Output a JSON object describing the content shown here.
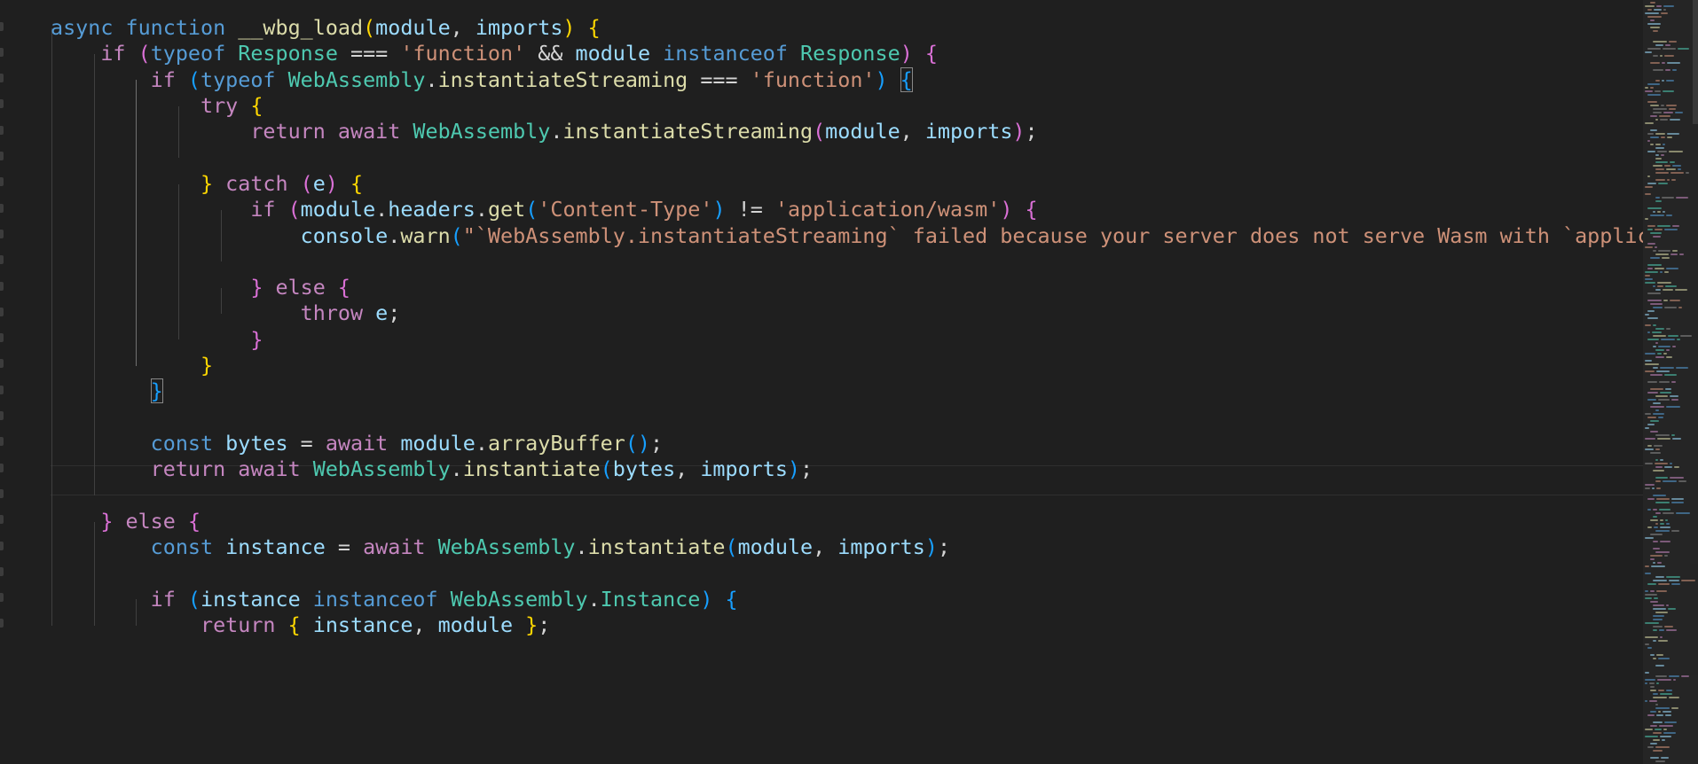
{
  "editor": {
    "theme": "dark",
    "background": "#1f1f1f",
    "language": "javascript",
    "lines": [
      [
        [
          "async ",
          "kw"
        ],
        [
          "function ",
          "kw"
        ],
        [
          "__wbg_load",
          "fn"
        ],
        [
          "(",
          "b1"
        ],
        [
          "module",
          "var"
        ],
        [
          ", ",
          "op"
        ],
        [
          "imports",
          "var"
        ],
        [
          ") ",
          "b1"
        ],
        [
          "{",
          "b1"
        ]
      ],
      [
        [
          "    "
        ],
        [
          "if ",
          "ctl"
        ],
        [
          "(",
          "b2"
        ],
        [
          "typeof ",
          "kw"
        ],
        [
          "Response ",
          "type"
        ],
        [
          "=== ",
          "op"
        ],
        [
          "'function'",
          "str"
        ],
        [
          " && ",
          "op"
        ],
        [
          "module ",
          "var"
        ],
        [
          "instanceof ",
          "kw"
        ],
        [
          "Response",
          "type"
        ],
        [
          ") ",
          "b2"
        ],
        [
          "{",
          "b2"
        ]
      ],
      [
        [
          "        "
        ],
        [
          "if ",
          "ctl"
        ],
        [
          "(",
          "b3"
        ],
        [
          "typeof ",
          "kw"
        ],
        [
          "WebAssembly",
          "type"
        ],
        [
          ".",
          "op"
        ],
        [
          "instantiateStreaming ",
          "fn"
        ],
        [
          "=== ",
          "op"
        ],
        [
          "'function'",
          "str"
        ],
        [
          ") ",
          "b3"
        ],
        [
          "{",
          "b3"
        ]
      ],
      [
        [
          "            "
        ],
        [
          "try ",
          "ctl"
        ],
        [
          "{",
          "b1"
        ]
      ],
      [
        [
          "                "
        ],
        [
          "return ",
          "ctl"
        ],
        [
          "await ",
          "ctl"
        ],
        [
          "WebAssembly",
          "type"
        ],
        [
          ".",
          "op"
        ],
        [
          "instantiateStreaming",
          "fn"
        ],
        [
          "(",
          "b2"
        ],
        [
          "module",
          "var"
        ],
        [
          ", ",
          "op"
        ],
        [
          "imports",
          "var"
        ],
        [
          ")",
          "b2"
        ],
        [
          ";",
          "op"
        ]
      ],
      [
        [
          ""
        ]
      ],
      [
        [
          "            "
        ],
        [
          "} ",
          "b1"
        ],
        [
          "catch ",
          "ctl"
        ],
        [
          "(",
          "b2"
        ],
        [
          "e",
          "var"
        ],
        [
          ") ",
          "b2"
        ],
        [
          "{",
          "b1"
        ]
      ],
      [
        [
          "                "
        ],
        [
          "if ",
          "ctl"
        ],
        [
          "(",
          "b2"
        ],
        [
          "module",
          "var"
        ],
        [
          ".",
          "op"
        ],
        [
          "headers",
          "var"
        ],
        [
          ".",
          "op"
        ],
        [
          "get",
          "fn"
        ],
        [
          "(",
          "b3"
        ],
        [
          "'Content-Type'",
          "str"
        ],
        [
          ") ",
          "b3"
        ],
        [
          "!= ",
          "op"
        ],
        [
          "'application/wasm'",
          "str"
        ],
        [
          ") ",
          "b2"
        ],
        [
          "{",
          "b2"
        ]
      ],
      [
        [
          "                    "
        ],
        [
          "console",
          "var"
        ],
        [
          ".",
          "op"
        ],
        [
          "warn",
          "fn"
        ],
        [
          "(",
          "b3"
        ],
        [
          "\"`WebAssembly.instantiateStreaming` failed because your server does not serve Wasm with `application/wasm` MIME type.\"",
          "str"
        ]
      ],
      [
        [
          ""
        ]
      ],
      [
        [
          "                "
        ],
        [
          "} ",
          "b2"
        ],
        [
          "else ",
          "ctl"
        ],
        [
          "{",
          "b2"
        ]
      ],
      [
        [
          "                    "
        ],
        [
          "throw ",
          "ctl"
        ],
        [
          "e",
          "var"
        ],
        [
          ";",
          "op"
        ]
      ],
      [
        [
          "                "
        ],
        [
          "}",
          "b2"
        ]
      ],
      [
        [
          "            "
        ],
        [
          "}",
          "b1"
        ]
      ],
      [
        [
          "        "
        ],
        [
          "}",
          "b3"
        ]
      ],
      [
        [
          ""
        ]
      ],
      [
        [
          "        "
        ],
        [
          "const ",
          "kw"
        ],
        [
          "bytes ",
          "var"
        ],
        [
          "= ",
          "op"
        ],
        [
          "await ",
          "ctl"
        ],
        [
          "module",
          "var"
        ],
        [
          ".",
          "op"
        ],
        [
          "arrayBuffer",
          "fn"
        ],
        [
          "()",
          "b3"
        ],
        [
          ";",
          "op"
        ]
      ],
      [
        [
          "        "
        ],
        [
          "return ",
          "ctl"
        ],
        [
          "await ",
          "ctl"
        ],
        [
          "WebAssembly",
          "type"
        ],
        [
          ".",
          "op"
        ],
        [
          "instantiate",
          "fn"
        ],
        [
          "(",
          "b3"
        ],
        [
          "bytes",
          "var"
        ],
        [
          ", ",
          "op"
        ],
        [
          "imports",
          "var"
        ],
        [
          ")",
          "b3"
        ],
        [
          ";",
          "op"
        ]
      ],
      [
        [
          ""
        ]
      ],
      [
        [
          "    "
        ],
        [
          "} ",
          "b2"
        ],
        [
          "else ",
          "ctl"
        ],
        [
          "{",
          "b2"
        ]
      ],
      [
        [
          "        "
        ],
        [
          "const ",
          "kw"
        ],
        [
          "instance ",
          "var"
        ],
        [
          "= ",
          "op"
        ],
        [
          "await ",
          "ctl"
        ],
        [
          "WebAssembly",
          "type"
        ],
        [
          ".",
          "op"
        ],
        [
          "instantiate",
          "fn"
        ],
        [
          "(",
          "b3"
        ],
        [
          "module",
          "var"
        ],
        [
          ", ",
          "op"
        ],
        [
          "imports",
          "var"
        ],
        [
          ")",
          "b3"
        ],
        [
          ";",
          "op"
        ]
      ],
      [
        [
          ""
        ]
      ],
      [
        [
          "        "
        ],
        [
          "if ",
          "ctl"
        ],
        [
          "(",
          "b3"
        ],
        [
          "instance ",
          "var"
        ],
        [
          "instanceof ",
          "kw"
        ],
        [
          "WebAssembly",
          "type"
        ],
        [
          ".",
          "op"
        ],
        [
          "Instance",
          "type"
        ],
        [
          ") ",
          "b3"
        ],
        [
          "{",
          "b3"
        ]
      ],
      [
        [
          "            "
        ],
        [
          "return ",
          "ctl"
        ],
        [
          "{ ",
          "b1"
        ],
        [
          "instance",
          "var"
        ],
        [
          ", ",
          "op"
        ],
        [
          "module ",
          "var"
        ],
        [
          "}",
          "b1"
        ],
        [
          ";",
          "op"
        ]
      ]
    ]
  },
  "colors": {
    "keyword": "#569cd6",
    "control": "#c586c0",
    "function": "#dcdcaa",
    "variable": "#9cdcfe",
    "type": "#4ec9b0",
    "string": "#ce9178",
    "bracket1": "#ffd700",
    "bracket2": "#da70d6",
    "bracket3": "#179fff"
  }
}
